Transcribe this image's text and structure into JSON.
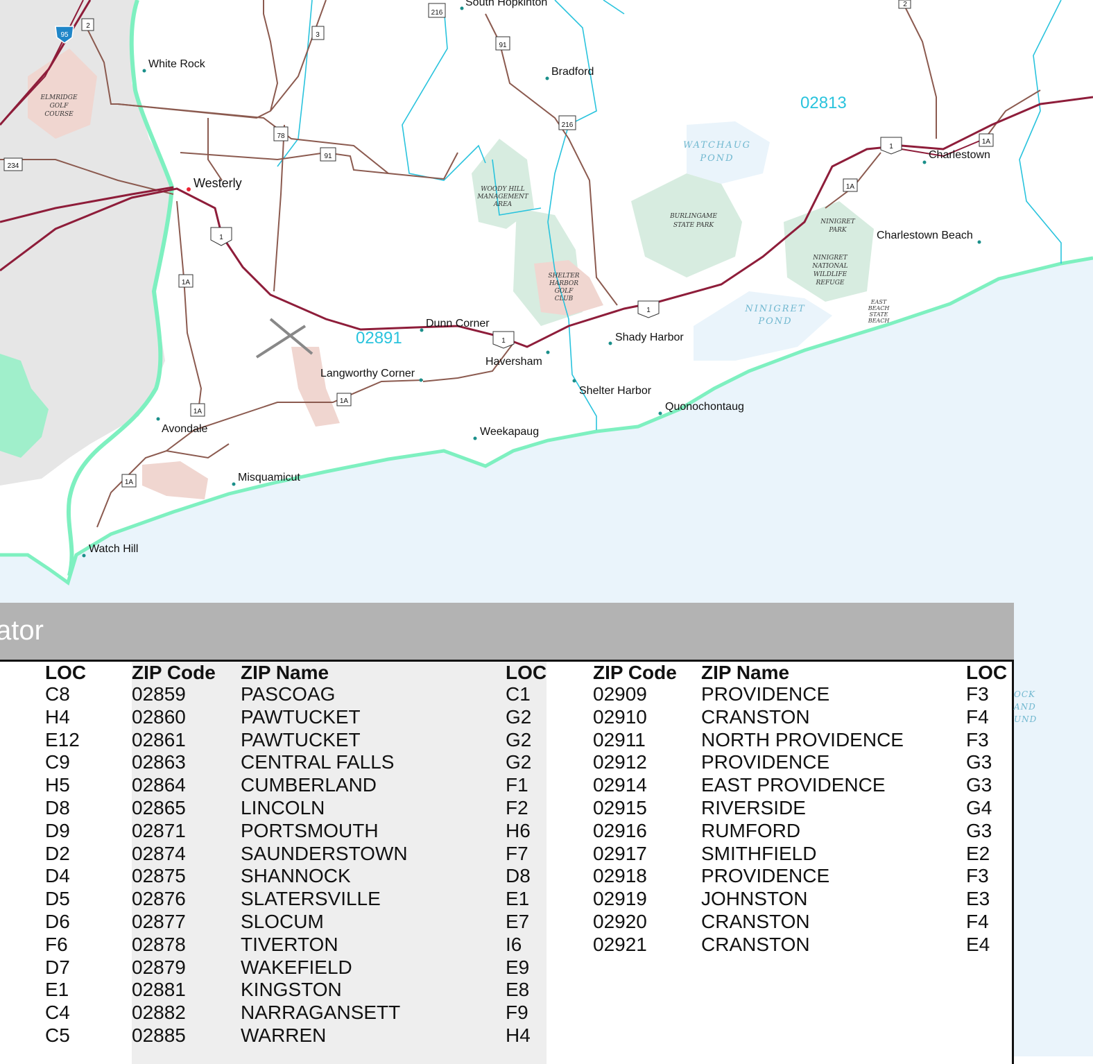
{
  "map": {
    "places": [
      {
        "id": "white-rock",
        "name": "White Rock"
      },
      {
        "id": "westerly",
        "name": "Westerly"
      },
      {
        "id": "bradford",
        "name": "Bradford"
      },
      {
        "id": "south-hopkinton",
        "name": "South Hopkinton"
      },
      {
        "id": "dunn-corner",
        "name": "Dunn Corner"
      },
      {
        "id": "haversham",
        "name": "Haversham"
      },
      {
        "id": "langworthy-corner",
        "name": "Langworthy Corner"
      },
      {
        "id": "shady-harbor",
        "name": "Shady Harbor"
      },
      {
        "id": "shelter-harbor",
        "name": "Shelter Harbor"
      },
      {
        "id": "quonochontaug",
        "name": "Quonochontaug"
      },
      {
        "id": "weekapaug",
        "name": "Weekapaug"
      },
      {
        "id": "avondale",
        "name": "Avondale"
      },
      {
        "id": "misquamicut",
        "name": "Misquamicut"
      },
      {
        "id": "watch-hill",
        "name": "Watch Hill"
      },
      {
        "id": "charlestown",
        "name": "Charlestown"
      },
      {
        "id": "charlestown-beach",
        "name": "Charlestown Beach"
      }
    ],
    "zip_labels": [
      "02813",
      "02891"
    ],
    "areas": {
      "elmridge": [
        "ELMRIDGE",
        "GOLF",
        "COURSE"
      ],
      "woody_hill": [
        "WOODY HILL",
        "MANAGEMENT",
        "AREA"
      ],
      "burlingame": [
        "BURLINGAME",
        "STATE PARK"
      ],
      "shelter_golf": [
        "SHELTER",
        "HARBOR",
        "GOLF",
        "CLUB"
      ],
      "ninigret_park": [
        "NINIGRET",
        "PARK"
      ],
      "ninigret_refuge": [
        "NINIGRET",
        "NATIONAL",
        "WILDLIFE",
        "REFUGE"
      ],
      "east_beach": [
        "EAST",
        "BEACH",
        "STATE",
        "BEACH"
      ]
    },
    "water": {
      "watchaug": [
        "WATCHAUG",
        "POND"
      ],
      "ninigret": [
        "NINIGRET",
        "POND"
      ]
    },
    "routes": {
      "interstate": "95",
      "us1": "1",
      "ri1a": "1A",
      "ri2": "2",
      "ri3": "3",
      "ri78": "78",
      "ri91": "91",
      "ri216": "216",
      "ri234": "234"
    }
  },
  "locator": {
    "title": "ator",
    "headers": {
      "loc": "LOC",
      "zip": "ZIP Code",
      "name": "ZIP Name"
    },
    "col0_loc": [
      "C8",
      "H4",
      "E12",
      "C9",
      "H5",
      "D8",
      "D9",
      "D2",
      "D4",
      "D5",
      "D6",
      "F6",
      "D7",
      "E1",
      "C4",
      "C5"
    ],
    "table1": [
      {
        "zip": "02859",
        "name": "PASCOAG",
        "loc": "C1"
      },
      {
        "zip": "02860",
        "name": "PAWTUCKET",
        "loc": "G2"
      },
      {
        "zip": "02861",
        "name": "PAWTUCKET",
        "loc": "G2"
      },
      {
        "zip": "02863",
        "name": "CENTRAL FALLS",
        "loc": "G2"
      },
      {
        "zip": "02864",
        "name": "CUMBERLAND",
        "loc": "F1"
      },
      {
        "zip": "02865",
        "name": "LINCOLN",
        "loc": "F2"
      },
      {
        "zip": "02871",
        "name": "PORTSMOUTH",
        "loc": "H6"
      },
      {
        "zip": "02874",
        "name": "SAUNDERSTOWN",
        "loc": "F7"
      },
      {
        "zip": "02875",
        "name": "SHANNOCK",
        "loc": "D8"
      },
      {
        "zip": "02876",
        "name": "SLATERSVILLE",
        "loc": "E1"
      },
      {
        "zip": "02877",
        "name": "SLOCUM",
        "loc": "E7"
      },
      {
        "zip": "02878",
        "name": "TIVERTON",
        "loc": "I6"
      },
      {
        "zip": "02879",
        "name": "WAKEFIELD",
        "loc": "E9"
      },
      {
        "zip": "02881",
        "name": "KINGSTON",
        "loc": "E8"
      },
      {
        "zip": "02882",
        "name": "NARRAGANSETT",
        "loc": "F9"
      },
      {
        "zip": "02885",
        "name": "WARREN",
        "loc": "H4"
      }
    ],
    "table2": [
      {
        "zip": "02909",
        "name": "PROVIDENCE",
        "loc": "F3"
      },
      {
        "zip": "02910",
        "name": "CRANSTON",
        "loc": "F4"
      },
      {
        "zip": "02911",
        "name": "NORTH PROVIDENCE",
        "loc": "F3"
      },
      {
        "zip": "02912",
        "name": "PROVIDENCE",
        "loc": "G3"
      },
      {
        "zip": "02914",
        "name": "EAST PROVIDENCE",
        "loc": "G3"
      },
      {
        "zip": "02915",
        "name": "RIVERSIDE",
        "loc": "G4"
      },
      {
        "zip": "02916",
        "name": "RUMFORD",
        "loc": "G3"
      },
      {
        "zip": "02917",
        "name": "SMITHFIELD",
        "loc": "E2"
      },
      {
        "zip": "02918",
        "name": "PROVIDENCE",
        "loc": "F3"
      },
      {
        "zip": "02919",
        "name": "JOHNSTON",
        "loc": "E3"
      },
      {
        "zip": "02920",
        "name": "CRANSTON",
        "loc": "F4"
      },
      {
        "zip": "02921",
        "name": "CRANSTON",
        "loc": "E4"
      }
    ],
    "edge_label": [
      "OCK",
      "AND",
      "UND"
    ]
  }
}
